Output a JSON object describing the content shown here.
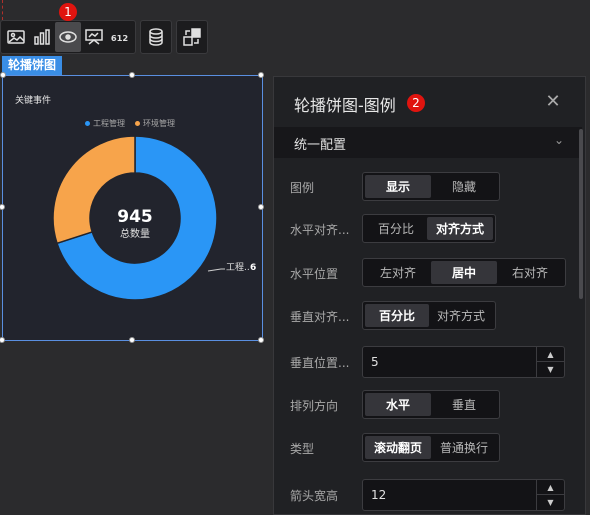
{
  "toolbar": {
    "groups": [
      [
        "image-icon",
        "bar-chart-icon",
        "carousel-icon",
        "presentation-icon",
        "number-icon"
      ],
      [
        "database-icon"
      ],
      [
        "swap-icon"
      ]
    ],
    "number_icon_text": "612",
    "badge1": "1"
  },
  "component_tag": "轮播饼图",
  "widget": {
    "title": "关键事件",
    "center_value": "945",
    "center_label": "总数量",
    "outer_label": "工程..",
    "outer_value": "6"
  },
  "chart_data": {
    "type": "pie",
    "title": "关键事件",
    "categories": [
      "工程管理",
      "环境管理"
    ],
    "values": [
      70,
      30
    ],
    "colors": [
      "#2a96f6",
      "#f7a44b"
    ],
    "center_value": "945",
    "center_label": "总数量",
    "legend": "top-center"
  },
  "panel": {
    "title": "轮播饼图-图例",
    "badge2": "2",
    "close": "✕",
    "section": "统一配置",
    "chevron": "⌄",
    "rows": [
      {
        "label": "图例",
        "options": [
          "显示",
          "隐藏"
        ],
        "selected": 0
      },
      {
        "label": "水平对齐...",
        "options": [
          "百分比",
          "对齐方式"
        ],
        "selected": 1
      },
      {
        "label": "水平位置",
        "options": [
          "左对齐",
          "居中",
          "右对齐"
        ],
        "selected": 1
      },
      {
        "label": "垂直对齐...",
        "options": [
          "百分比",
          "对齐方式"
        ],
        "selected": 0
      },
      {
        "label": "垂直位置...",
        "value": "5"
      },
      {
        "label": "排列方向",
        "options": [
          "水平",
          "垂直"
        ],
        "selected": 0
      },
      {
        "label": "类型",
        "options": [
          "滚动翻页",
          "普通换行"
        ],
        "selected": 0
      },
      {
        "label": "箭头宽高",
        "value": "12"
      }
    ]
  }
}
